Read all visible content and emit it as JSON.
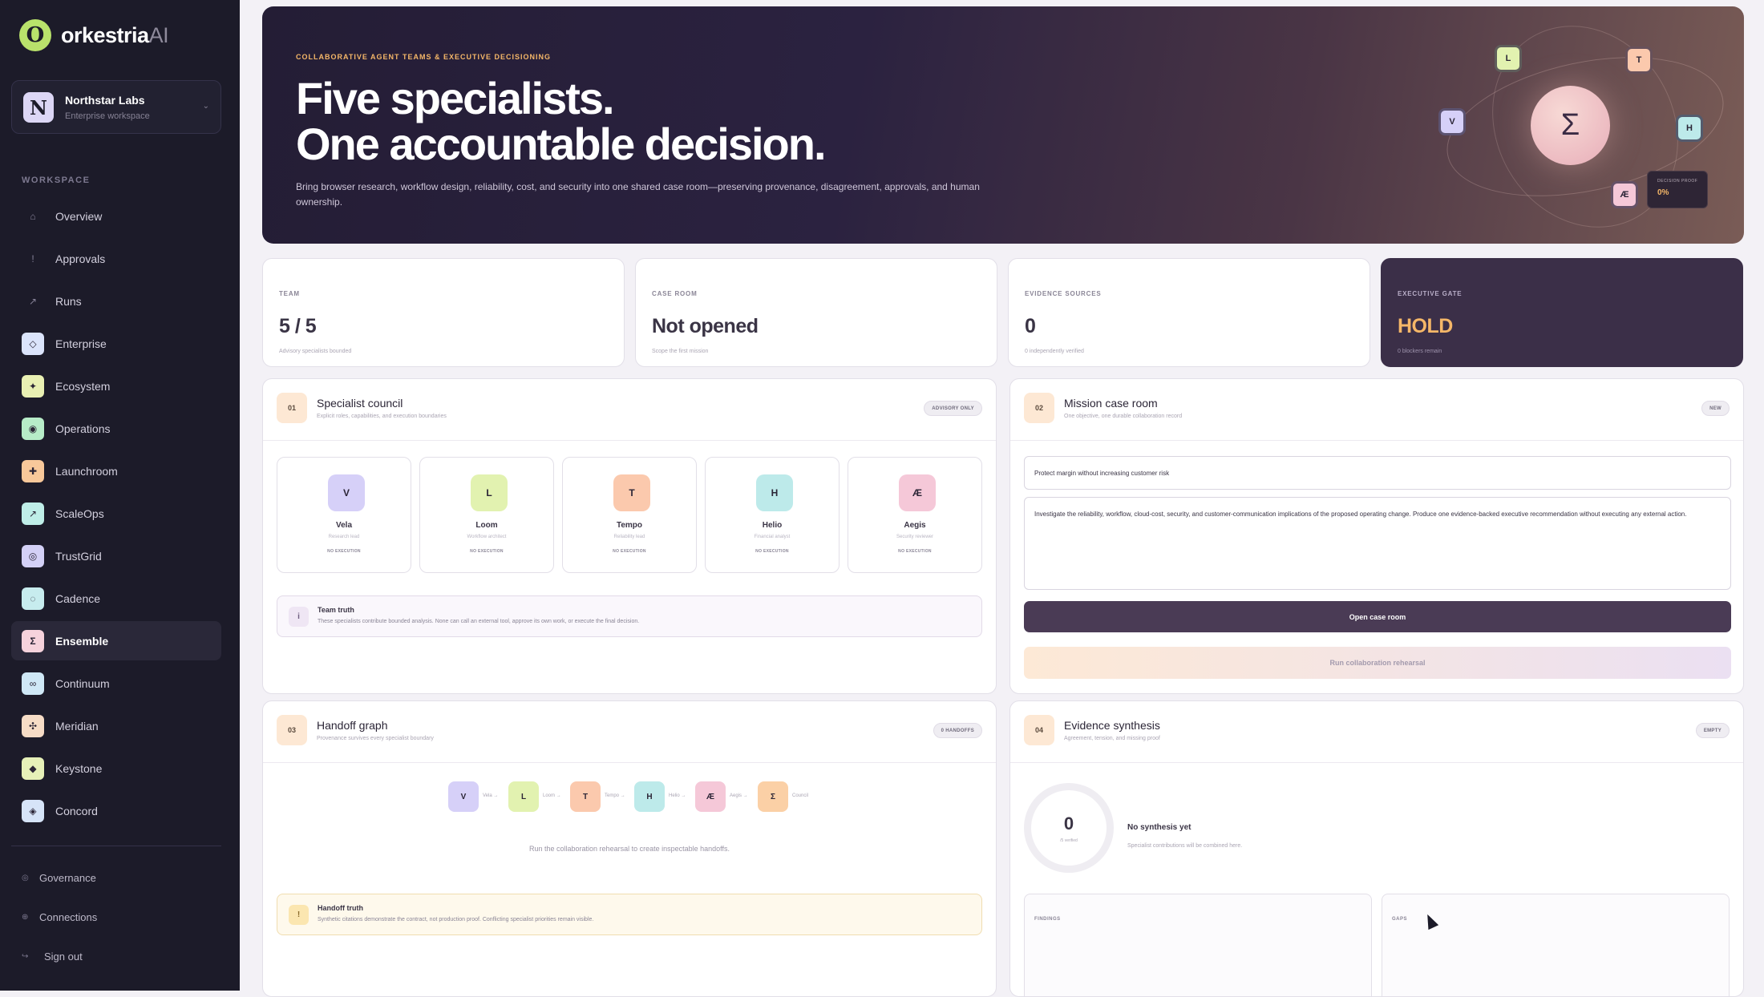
{
  "brand": {
    "name": "orkestria",
    "suffix": "AI",
    "mark": "O"
  },
  "workspace": {
    "avatar": "N",
    "name": "Northstar Labs",
    "sub": "Enterprise workspace",
    "chev": "⌄"
  },
  "sidebar": {
    "section_label": "WORKSPACE",
    "items": [
      {
        "label": "Overview",
        "icon": "⌂",
        "icon_name": "home-icon",
        "color": ""
      },
      {
        "label": "Approvals",
        "icon": "!",
        "icon_name": "alert-icon",
        "color": ""
      },
      {
        "label": "Runs",
        "icon": "↗",
        "icon_name": "arrow-icon",
        "color": ""
      },
      {
        "label": "Enterprise",
        "icon": "◇",
        "icon_name": "diamond-icon",
        "color": "#dbe4fb"
      },
      {
        "label": "Ecosystem",
        "icon": "✦",
        "icon_name": "sparkle-icon",
        "color": "#e9f0b3"
      },
      {
        "label": "Operations",
        "icon": "◉",
        "icon_name": "circle-icon",
        "color": "#b7ecc8"
      },
      {
        "label": "Launchroom",
        "icon": "✚",
        "icon_name": "plus-icon",
        "color": "#f8c89a"
      },
      {
        "label": "ScaleOps",
        "icon": "↗",
        "icon_name": "scale-icon",
        "color": "#bfeee8"
      },
      {
        "label": "TrustGrid",
        "icon": "◎",
        "icon_name": "grid-icon",
        "color": "#d3d0f6"
      },
      {
        "label": "Cadence",
        "icon": "◌",
        "icon_name": "cadence-icon",
        "color": "#c7ecee"
      },
      {
        "label": "Ensemble",
        "icon": "Σ",
        "icon_name": "sigma-icon",
        "color": "#f6d2dc"
      },
      {
        "label": "Continuum",
        "icon": "∞",
        "icon_name": "infinity-icon",
        "color": "#cfe8f6"
      },
      {
        "label": "Meridian",
        "icon": "✣",
        "icon_name": "meridian-icon",
        "color": "#f6dcc6"
      },
      {
        "label": "Keystone",
        "icon": "◆",
        "icon_name": "keystone-icon",
        "color": "#e6f0b8"
      },
      {
        "label": "Concord",
        "icon": "◈",
        "icon_name": "concord-icon",
        "color": "#d6e4f8"
      }
    ],
    "bottom": [
      {
        "label": "Governance",
        "icon": "◎"
      },
      {
        "label": "Connections",
        "icon": "⊕"
      },
      {
        "label": "Sign out",
        "icon": "↪"
      }
    ]
  },
  "hero": {
    "eyebrow": "COLLABORATIVE AGENT TEAMS & EXECUTIVE DECISIONING",
    "title_line1": "Five specialists.",
    "title_line2": "One accountable decision.",
    "desc": "Bring browser research, workflow design, reliability, cost, and security into one shared case room—preserving provenance, disagreement, approvals, and human ownership.",
    "center": "Σ",
    "nodes": [
      "L",
      "T",
      "V",
      "H",
      "Æ"
    ],
    "proof_label": "DECISION PROOF",
    "proof_value": "0%"
  },
  "kpis": [
    {
      "label": "TEAM",
      "value": "5 / 5",
      "sub": "Advisory specialists bounded"
    },
    {
      "label": "CASE ROOM",
      "value": "Not opened",
      "sub": "Scope the first mission"
    },
    {
      "label": "EVIDENCE SOURCES",
      "value": "0",
      "sub": "0 independently verified"
    },
    {
      "label": "EXECUTIVE GATE",
      "value": "HOLD",
      "sub": "0 blockers remain"
    }
  ],
  "council": {
    "num": "01",
    "title": "Specialist council",
    "sub": "Explicit roles, capabilities, and execution boundaries",
    "badge": "ADVISORY ONLY",
    "specialists": [
      {
        "initial": "V",
        "name": "Vela",
        "role": "Research lead",
        "exec": "NO EXECUTION",
        "color": "#d6d0f8"
      },
      {
        "initial": "L",
        "name": "Loom",
        "role": "Workflow architect",
        "exec": "NO EXECUTION",
        "color": "#e2f2b0"
      },
      {
        "initial": "T",
        "name": "Tempo",
        "role": "Reliability lead",
        "exec": "NO EXECUTION",
        "color": "#fbc9ad"
      },
      {
        "initial": "H",
        "name": "Helio",
        "role": "Financial analyst",
        "exec": "NO EXECUTION",
        "color": "#bdeaea"
      },
      {
        "initial": "Æ",
        "name": "Aegis",
        "role": "Security reviewer",
        "exec": "NO EXECUTION",
        "color": "#f5c8d8"
      }
    ],
    "note_icon": "i",
    "note_title": "Team truth",
    "note_text": "These specialists contribute bounded analysis. None can call an external tool, approve its own work, or execute the final decision."
  },
  "mission": {
    "num": "02",
    "title": "Mission case room",
    "sub": "One objective, one durable collaboration record",
    "badge": "NEW",
    "objective": "Protect margin without increasing customer risk",
    "brief": "Investigate the reliability, workflow, cloud-cost, security, and customer-communication implications of the proposed operating change. Produce one evidence-backed executive recommendation without executing any external action.",
    "open_label": "Open case room",
    "rehearsal_label": "Run collaboration rehearsal"
  },
  "handoff": {
    "num": "03",
    "title": "Handoff graph",
    "sub": "Provenance survives every specialist boundary",
    "badge": "0 HANDOFFS",
    "nodes": [
      {
        "initial": "V",
        "label": "Vela",
        "color": "#d6d0f8"
      },
      {
        "initial": "L",
        "label": "Loom",
        "color": "#e2f2b0"
      },
      {
        "initial": "T",
        "label": "Tempo",
        "color": "#fbc9ad"
      },
      {
        "initial": "H",
        "label": "Helio",
        "color": "#bdeaea"
      },
      {
        "initial": "Æ",
        "label": "Aegis",
        "color": "#f5c8d8"
      },
      {
        "initial": "Σ",
        "label": "Council",
        "color": "#fbd0a6"
      }
    ],
    "arrow": "→",
    "empty": "Run the collaboration rehearsal to create inspectable handoffs.",
    "note_icon": "!",
    "note_title": "Handoff truth",
    "note_text": "Synthetic citations demonstrate the contract, not production proof. Conflicting specialist priorities remain visible."
  },
  "synthesis": {
    "num": "04",
    "title": "Evidence synthesis",
    "sub": "Agreement, tension, and missing proof",
    "badge": "EMPTY",
    "ring_value": "0",
    "ring_sub": "/5 verified",
    "title2": "No synthesis yet",
    "sub2": "Specialist contributions will be combined here.",
    "findings_label": "FINDINGS",
    "gaps_label": "GAPS"
  },
  "colors": {
    "sidebar": "#1c1b29",
    "accent": "#f5b768",
    "primary_btn": "#4a3b55"
  }
}
